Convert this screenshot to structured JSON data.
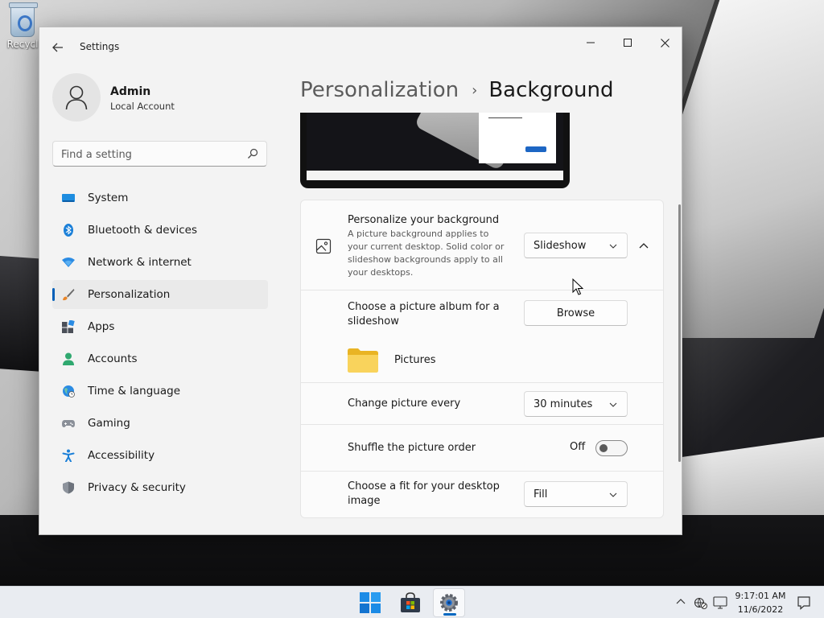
{
  "desktop": {
    "recycle_bin_label": "Recycl"
  },
  "window": {
    "app_title": "Settings"
  },
  "profile": {
    "name": "Admin",
    "account_type": "Local Account"
  },
  "search": {
    "placeholder": "Find a setting"
  },
  "nav": {
    "items": [
      {
        "label": "System",
        "icon": "system-icon"
      },
      {
        "label": "Bluetooth & devices",
        "icon": "bluetooth-icon"
      },
      {
        "label": "Network & internet",
        "icon": "network-icon"
      },
      {
        "label": "Personalization",
        "icon": "brush-icon",
        "active": true
      },
      {
        "label": "Apps",
        "icon": "apps-icon"
      },
      {
        "label": "Accounts",
        "icon": "accounts-icon"
      },
      {
        "label": "Time & language",
        "icon": "globe-icon"
      },
      {
        "label": "Gaming",
        "icon": "gamepad-icon"
      },
      {
        "label": "Accessibility",
        "icon": "accessibility-icon"
      },
      {
        "label": "Privacy & security",
        "icon": "shield-icon"
      }
    ]
  },
  "breadcrumb": {
    "parent": "Personalization",
    "separator": "›",
    "current": "Background"
  },
  "background": {
    "personalize": {
      "title": "Personalize your background",
      "description": "A picture background applies to your current desktop. Solid color or slideshow backgrounds apply to all your desktops.",
      "value": "Slideshow"
    },
    "album": {
      "title": "Choose a picture album for a slideshow",
      "browse_label": "Browse",
      "folder_name": "Pictures"
    },
    "change_every": {
      "title": "Change picture every",
      "value": "30 minutes"
    },
    "shuffle": {
      "title": "Shuffle the picture order",
      "state_label": "Off",
      "on": false
    },
    "fit": {
      "title": "Choose a fit for your desktop image",
      "value": "Fill"
    }
  },
  "taskbar": {
    "time": "9:17:01 AM",
    "date": "11/6/2022"
  },
  "colors": {
    "accent": "#005fb8",
    "window_bg": "#f3f3f3",
    "card_bg": "#fbfbfb",
    "folder_yellow": "#f6c83f"
  }
}
